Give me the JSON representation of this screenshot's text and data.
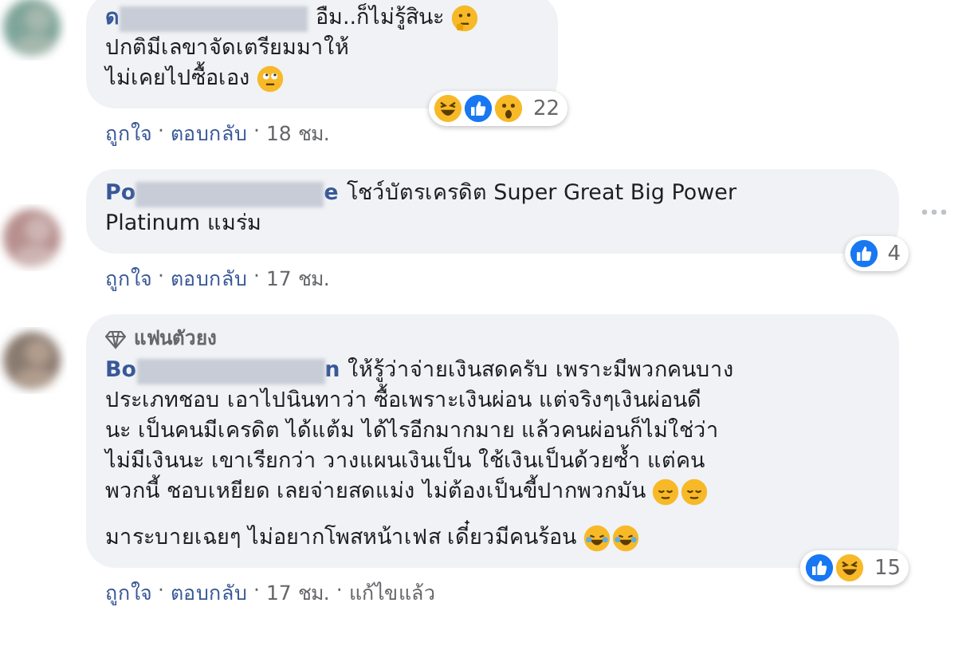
{
  "comments": [
    {
      "name_start": "ด",
      "paragraphs": [
        [
          {
            "text": "อืม..ก็ไม่รู้สินะ",
            "emojis": [
              {
                "kind": "thinking"
              }
            ]
          },
          {
            "text": "ปกติมีเลขาจัดเตรียมมาให้"
          },
          {
            "text": "ไม่เคยไปซื้อเอง",
            "emojis": [
              {
                "kind": "eyeroll"
              }
            ]
          }
        ]
      ],
      "reactions": [
        {
          "kind": "laugh"
        },
        {
          "kind": "like"
        },
        {
          "kind": "wow"
        }
      ],
      "reaction_count": "22",
      "actions": [
        "ถูกใจ",
        "ตอบกลับ",
        "18 ชม."
      ],
      "separator": "·",
      "menu": false
    },
    {
      "name_start": "Po",
      "name_end": "e",
      "paragraphs": [
        [
          {
            "text": "โชว์บัตรเครดิต Super Great Big Power"
          },
          {
            "text": "Platinum แมร่ม"
          }
        ]
      ],
      "reactions": [
        {
          "kind": "like"
        }
      ],
      "reaction_count": "4",
      "actions": [
        "ถูกใจ",
        "ตอบกลับ",
        "17 ชม."
      ],
      "separator": "·",
      "menu": true
    },
    {
      "badge": "แฟนตัวยง",
      "name_start": "Bo",
      "name_end": "n",
      "paragraphs": [
        [
          {
            "text": "ให้รู้ว่าจ่ายเงินสดครับ เพราะมีพวกคนบาง"
          },
          {
            "text": "ประเภทชอบ เอาไปนินทาว่า ซื้อเพราะเงินผ่อน แต่จริงๆเงินผ่อนดี"
          },
          {
            "text": "นะ เป็นคนมีเครดิต ได้แต้ม ได้ไรอีกมากมาย แล้วคนผ่อนก็ไม่ใช่ว่า"
          },
          {
            "text": "ไม่มีเงินนะ เขาเรียกว่า วางแผนเงินเป็น ใช้เงินเป็นด้วยซ้ำ แต่คน"
          },
          {
            "text": "พวกนี้ ชอบเหยียด เลยจ่ายสดแม่ง ไม่ต้องเป็นขี้ปากพวกมัน",
            "emojis": [
              {
                "kind": "relieved"
              },
              {
                "kind": "relieved"
              }
            ]
          }
        ],
        [
          {
            "text": "มาระบายเฉยๆ ไม่อยากโพสหน้าเฟส เดี๋ยวมีคนร้อน",
            "emojis": [
              {
                "kind": "joy"
              },
              {
                "kind": "joy"
              }
            ]
          }
        ]
      ],
      "reactions": [
        {
          "kind": "like"
        },
        {
          "kind": "laugh"
        }
      ],
      "reaction_count": "15",
      "actions": [
        "ถูกใจ",
        "ตอบกลับ",
        "17 ชม.",
        "แก้ไขแล้ว"
      ],
      "separator": "·",
      "menu": false
    }
  ]
}
